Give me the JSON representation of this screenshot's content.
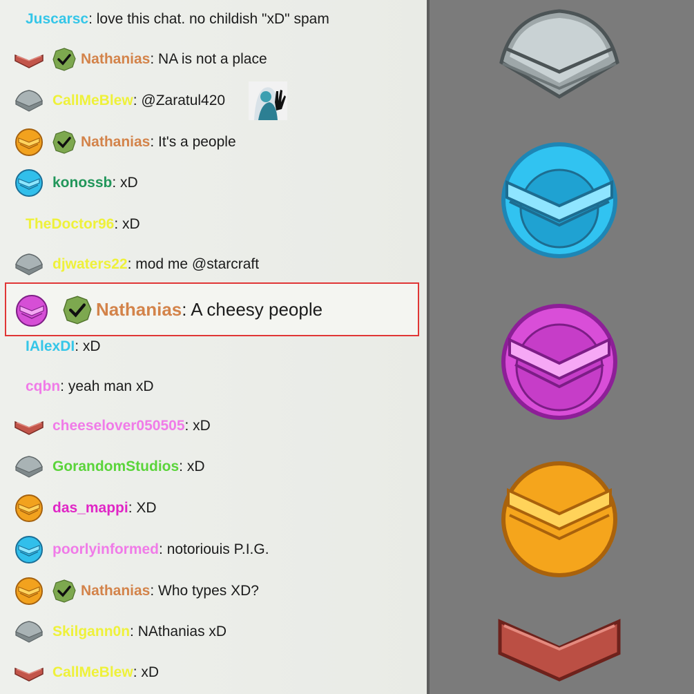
{
  "colors": {
    "cyan": "#35c6e8",
    "orange": "#d3834a",
    "yellow": "#eef13a",
    "green": "#21965a",
    "lime": "#5ad43a",
    "pink": "#f07be8",
    "magenta": "#e026c6",
    "sky": "#54c7f0",
    "highlight_border": "#e03535"
  },
  "messages": [
    {
      "user": "Juscarsc",
      "text": "love this chat. no childish \"xD\" spam",
      "color": "#35c6e8",
      "badge": "none",
      "check": false
    },
    {
      "user": "Nathanias",
      "text": "NA is not a place",
      "color": "#d3834a",
      "badge": "red-chevron",
      "check": true
    },
    {
      "user": "CallMeBlew",
      "text": "@Zaratul420",
      "color": "#eef13a",
      "badge": "gray-chevron",
      "check": false,
      "emote": "wave-emote"
    },
    {
      "user": "Nathanias",
      "text": "It's a people",
      "color": "#d3834a",
      "badge": "orange-orb",
      "check": true
    },
    {
      "user": "konossb",
      "text": "xD",
      "color": "#21965a",
      "badge": "blue-orb",
      "check": false
    },
    {
      "user": "TheDoctor96",
      "text": "xD",
      "color": "#eef13a",
      "badge": "none",
      "check": false
    },
    {
      "user": "djwaters22",
      "text": "mod me @starcraft",
      "color": "#eef13a",
      "badge": "gray-chevron",
      "check": false
    },
    {
      "user": "Nathanias",
      "text": "A cheesy people",
      "color": "#d3834a",
      "badge": "purple-orb",
      "check": true,
      "highlighted": true
    },
    {
      "user": "IAlexDI",
      "text": "xD",
      "color": "#35c6e8",
      "badge": "none",
      "check": false
    },
    {
      "user": "cqbn",
      "text": "yeah man xD",
      "color": "#f07be8",
      "badge": "none",
      "check": false
    },
    {
      "user": "cheeselover050505",
      "text": "xD",
      "color": "#f07be8",
      "badge": "red-chevron",
      "check": false
    },
    {
      "user": "GorandomStudios",
      "text": "xD",
      "color": "#5ad43a",
      "badge": "gray-chevron",
      "check": false
    },
    {
      "user": "das_mappi",
      "text": "XD",
      "color": "#e026c6",
      "badge": "orange-orb",
      "check": false
    },
    {
      "user": "poorlyinformed",
      "text": "notoriouis P.I.G.",
      "color": "#f07be8",
      "badge": "blue-orb",
      "check": false
    },
    {
      "user": "Nathanias",
      "text": "Who types XD?",
      "color": "#d3834a",
      "badge": "orange-orb",
      "check": true
    },
    {
      "user": "Skilgann0n",
      "text": "NAthanias xD",
      "color": "#eef13a",
      "badge": "gray-chevron",
      "check": false
    },
    {
      "user": "CallMeBlew",
      "text": "xD",
      "color": "#eef13a",
      "badge": "red-chevron",
      "check": false
    }
  ],
  "legend_badges": [
    "gray-chevron-badge",
    "blue-orb-badge",
    "purple-orb-badge",
    "orange-orb-badge",
    "red-chevron-badge"
  ]
}
